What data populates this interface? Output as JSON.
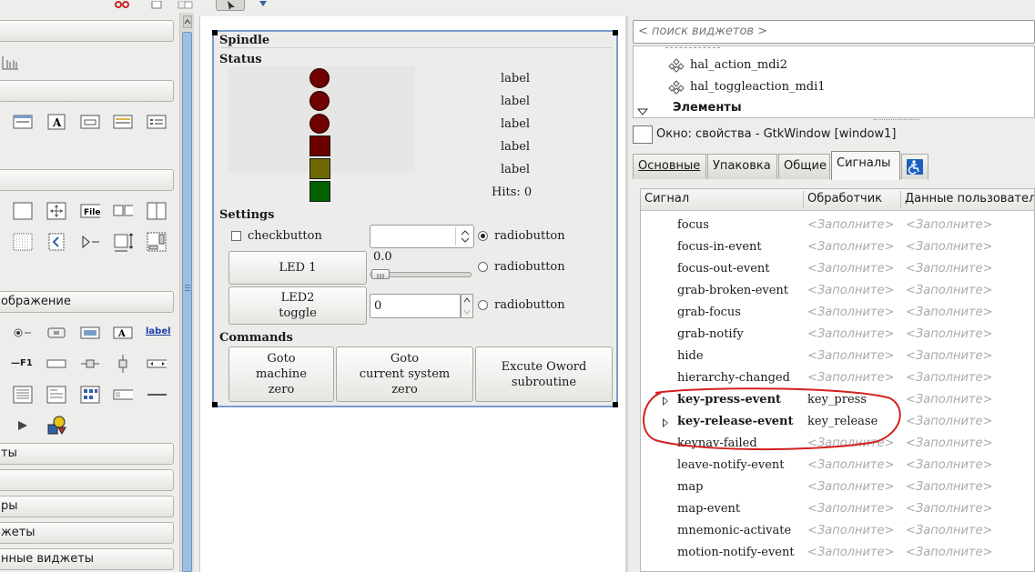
{
  "palette": {
    "group_labels": [
      "",
      "",
      "",
      "",
      "ображение",
      "ты",
      "",
      "ры",
      "жеты",
      "нные виджеты"
    ],
    "file_icon_label": "File",
    "a_icon_label": "A",
    "label_icon_label": "label",
    "f1_icon_label": "F1"
  },
  "canvas": {
    "window": {
      "spindle_label": "Spindle",
      "status_label": "Status",
      "status_labels": [
        "label",
        "label",
        "label",
        "label",
        "label"
      ],
      "hits_label": "Hits: 0",
      "settings_label": "Settings",
      "checkbutton_label": "checkbutton",
      "combo_value": "",
      "radio_labels": [
        "radiobutton",
        "radiobutton",
        "radiobutton"
      ],
      "led1_label": "LED 1",
      "led2_label": "LED2\ntoggle",
      "scale_value": "0.0",
      "spin_value": "0",
      "commands_label": "Commands",
      "cmd_buttons": [
        "Goto\nmachine\nzero",
        "Goto\ncurrent system\nzero",
        "Excute Oword\nsubroutine"
      ],
      "led_colors": [
        "#700000",
        "#700000",
        "#700000"
      ],
      "square_colors": [
        "#6b0000",
        "#6c6a00",
        "#006400"
      ]
    }
  },
  "right": {
    "search_placeholder": "< поиск виджетов >",
    "tree_items": [
      "hal_action_mdi2",
      "hal_toggleaction_mdi1"
    ],
    "tree_group": "Элементы",
    "prop_title": "Окно: свойства - GtkWindow [window1]",
    "tabs": [
      "Основные",
      "Упаковка",
      "Общие",
      "Сигналы"
    ],
    "active_tab": "Сигналы",
    "columns": [
      "Сигнал",
      "Обработчик",
      "Данные пользовател"
    ],
    "placeholder": "<Заполните>",
    "signals": [
      {
        "name": "focus",
        "handler": "<Заполните>"
      },
      {
        "name": "focus-in-event",
        "handler": "<Заполните>"
      },
      {
        "name": "focus-out-event",
        "handler": "<Заполните>"
      },
      {
        "name": "grab-broken-event",
        "handler": "<Заполните>"
      },
      {
        "name": "grab-focus",
        "handler": "<Заполните>"
      },
      {
        "name": "grab-notify",
        "handler": "<Заполните>"
      },
      {
        "name": "hide",
        "handler": "<Заполните>"
      },
      {
        "name": "hierarchy-changed",
        "handler": "<Заполните>"
      },
      {
        "name": "key-press-event",
        "handler": "key_press"
      },
      {
        "name": "key-release-event",
        "handler": "key_release"
      },
      {
        "name": "keynav-failed",
        "handler": "<Заполните>"
      },
      {
        "name": "leave-notify-event",
        "handler": "<Заполните>"
      },
      {
        "name": "map",
        "handler": "<Заполните>"
      },
      {
        "name": "map-event",
        "handler": "<Заполните>"
      },
      {
        "name": "mnemonic-activate",
        "handler": "<Заполните>"
      },
      {
        "name": "motion-notify-event",
        "handler": "<Заполните>"
      }
    ],
    "annotation_color": "#d42020"
  }
}
